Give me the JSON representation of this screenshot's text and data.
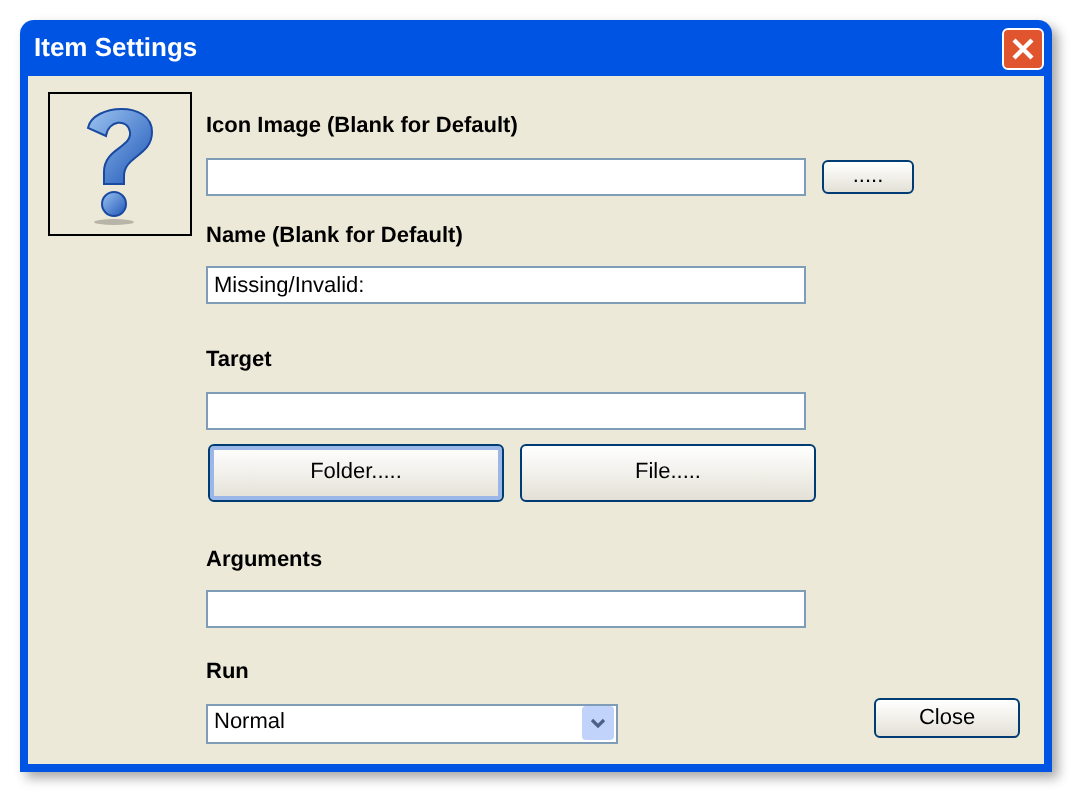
{
  "window": {
    "title": "Item Settings"
  },
  "fields": [
    {
      "kind": "text",
      "label": "Icon Image (Blank for Default)",
      "button": "....."
    },
    {
      "kind": "text",
      "label": "Name (Blank for Default)",
      "value": "Missing/Invalid:"
    },
    {
      "kind": "text",
      "label": "Target",
      "buttons": [
        {
          "label": "Folder.....",
          "focused": true
        },
        {
          "label": "File.....",
          "focused": false
        }
      ]
    },
    {
      "kind": "text",
      "label": "Arguments"
    },
    {
      "kind": "select",
      "label": "Run",
      "value": "Normal"
    }
  ],
  "close_button": "Close"
}
